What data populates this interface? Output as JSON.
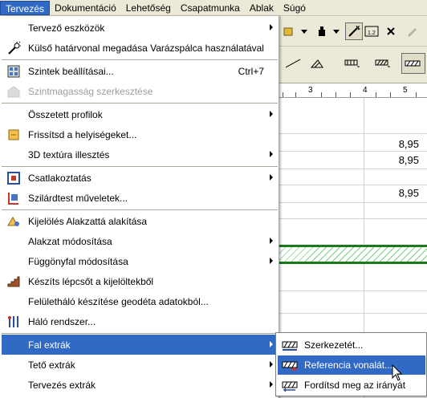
{
  "menubar": {
    "items": [
      "Tervezés",
      "Dokumentáció",
      "Lehetőség",
      "Csapatmunka",
      "Ablak",
      "Súgó"
    ],
    "active_index": 0
  },
  "menu": {
    "items": [
      {
        "label": "Tervező eszközök",
        "icon": "none",
        "submenu": true
      },
      {
        "label": "Külső határvonal megadása Varázspálca használatával",
        "icon": "magic-wand-icon"
      },
      {
        "label": "Szintek beállításai...",
        "icon": "stories-icon",
        "shortcut": "Ctrl+7"
      },
      {
        "label": "Szintmagasság szerkesztése",
        "icon": "story-height-icon",
        "disabled": true
      },
      {
        "label": "Összetett profilok",
        "icon": "none",
        "submenu": true
      },
      {
        "label": "Frissítsd a helyiségeket...",
        "icon": "zone-update-icon"
      },
      {
        "label": "3D textúra illesztés",
        "icon": "none",
        "submenu": true
      },
      {
        "label": "Csatlakoztatás",
        "icon": "connect-icon",
        "submenu": true
      },
      {
        "label": "Szilárdtest műveletek...",
        "icon": "solid-operations-icon"
      },
      {
        "label": "Kijelölés Alakzattá alakítása",
        "icon": "convert-to-morph-icon"
      },
      {
        "label": "Alakzat módosítása",
        "icon": "none",
        "submenu": true
      },
      {
        "label": "Függönyfal módosítása",
        "icon": "none",
        "submenu": true
      },
      {
        "label": "Készíts lépcsőt a kijelöltekből",
        "icon": "stair-icon"
      },
      {
        "label": "Felületháló készítése geodéta adatokból...",
        "icon": "none"
      },
      {
        "label": "Háló rendszer...",
        "icon": "grid-system-icon"
      },
      {
        "label": "Fal extrák",
        "icon": "none",
        "submenu": true,
        "highlighted": true
      },
      {
        "label": "Tető extrák",
        "icon": "none",
        "submenu": true
      },
      {
        "label": "Tervezés extrák",
        "icon": "none",
        "submenu": true
      }
    ]
  },
  "submenu": {
    "items": [
      {
        "label": "Szerkezetét...",
        "icon": "wall-structure-icon"
      },
      {
        "label": "Referencia vonalát...",
        "icon": "wall-reference-line-icon",
        "highlighted": true
      },
      {
        "label": "Fordítsd meg az irányát",
        "icon": "wall-direction-icon"
      }
    ]
  },
  "background": {
    "ruler_numbers": [
      "3",
      "4",
      "5"
    ],
    "values": [
      "8,95",
      "8,95",
      "8,95"
    ]
  },
  "colors": {
    "highlight": "#316ac5",
    "menubar": "#ece9d8",
    "hatch": "#1a7a1a"
  }
}
